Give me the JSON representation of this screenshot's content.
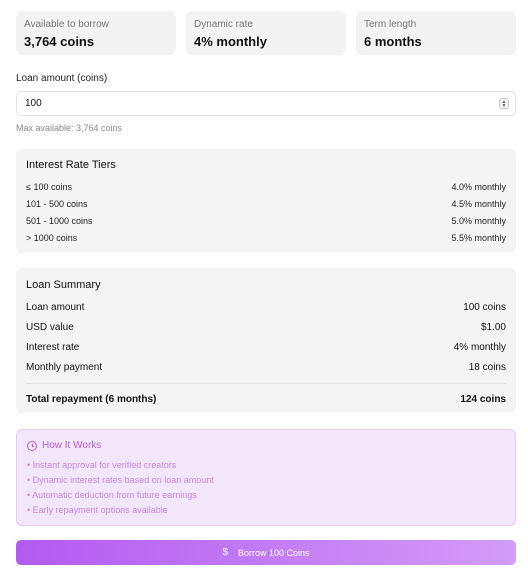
{
  "stats": [
    {
      "label": "Available to borrow",
      "value": "3,764 coins"
    },
    {
      "label": "Dynamic rate",
      "value": "4% monthly"
    },
    {
      "label": "Term length",
      "value": "6 months"
    }
  ],
  "loan_input": {
    "label": "Loan amount (coins)",
    "value": "100",
    "hint": "Max available: 3,764 coins"
  },
  "tiers": {
    "title": "Interest Rate Tiers",
    "rows": [
      {
        "range": "≤ 100 coins",
        "rate": "4.0% monthly"
      },
      {
        "range": "101 - 500 coins",
        "rate": "4.5% monthly"
      },
      {
        "range": "501 - 1000 coins",
        "rate": "5.0% monthly"
      },
      {
        "range": "> 1000 coins",
        "rate": "5.5% monthly"
      }
    ]
  },
  "summary": {
    "title": "Loan Summary",
    "rows": [
      {
        "label": "Loan amount",
        "value": "100 coins"
      },
      {
        "label": "USD value",
        "value": "$1.00"
      },
      {
        "label": "Interest rate",
        "value": "4% monthly"
      },
      {
        "label": "Monthly payment",
        "value": "18 coins"
      }
    ],
    "total_label": "Total repayment (6 months)",
    "total_value": "124 coins"
  },
  "how": {
    "title": "How It Works",
    "icon": "clock-icon",
    "items": [
      "• Instant approval for verified creators",
      "• Dynamic interest rates based on loan amount",
      "• Automatic deduction from future earnings",
      "• Early repayment options available"
    ]
  },
  "cta": {
    "icon_glyph": "$",
    "label": "Borrow 100 Coins"
  },
  "colors": {
    "accent": "#b35af0",
    "accent_light": "#d39cf8",
    "info_bg": "#f3e6fb"
  }
}
